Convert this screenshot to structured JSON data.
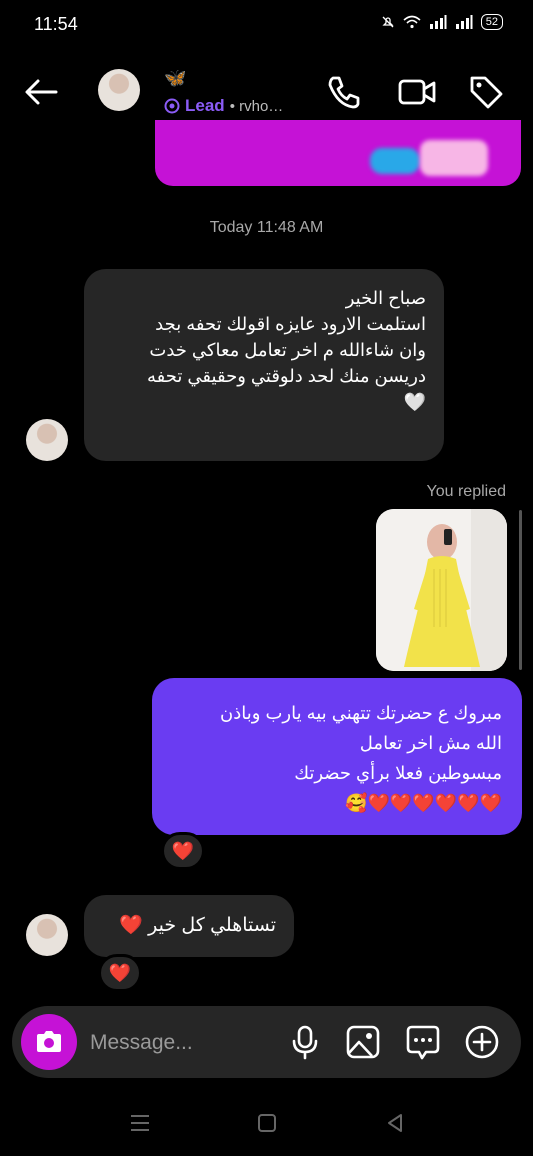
{
  "status_bar": {
    "time": "11:54",
    "battery": "52"
  },
  "header": {
    "emoji": "🦋",
    "label": "Lead",
    "handle": "• rvho…"
  },
  "messages": {
    "timestamp": "Today 11:48 AM",
    "incoming_1": "صباح الخير\nاستلمت الارود عايزه اقولك تحفه بجد\nوان شاءالله م اخر تعامل معاكي خدت\nدريسن منك لحد دلوقتي وحقيقي تحفه\n🤍",
    "you_replied": "You replied",
    "outgoing_1": "مبروك ع حضرتك تتهني بيه يارب وباذن\nالله مش اخر تعامل\nمبسوطين فعلا برأي حضرتك\n❤️❤️❤️❤️❤️❤️🥰",
    "reaction_1": "❤️",
    "incoming_2": "تستاهلي كل خير ❤️",
    "reaction_2": "❤️"
  },
  "composer": {
    "placeholder": "Message..."
  },
  "colors": {
    "accent_purple": "#6a3cf2",
    "accent_magenta": "#c512d6",
    "lead_purple": "#8b5cf6",
    "bubble_dark": "#262626"
  },
  "icons": [
    "back-arrow-icon",
    "phone-icon",
    "video-icon",
    "tag-icon",
    "camera-icon",
    "mic-icon",
    "gallery-icon",
    "sticker-icon",
    "plus-icon",
    "menu-icon",
    "home-icon",
    "back-nav-icon"
  ]
}
